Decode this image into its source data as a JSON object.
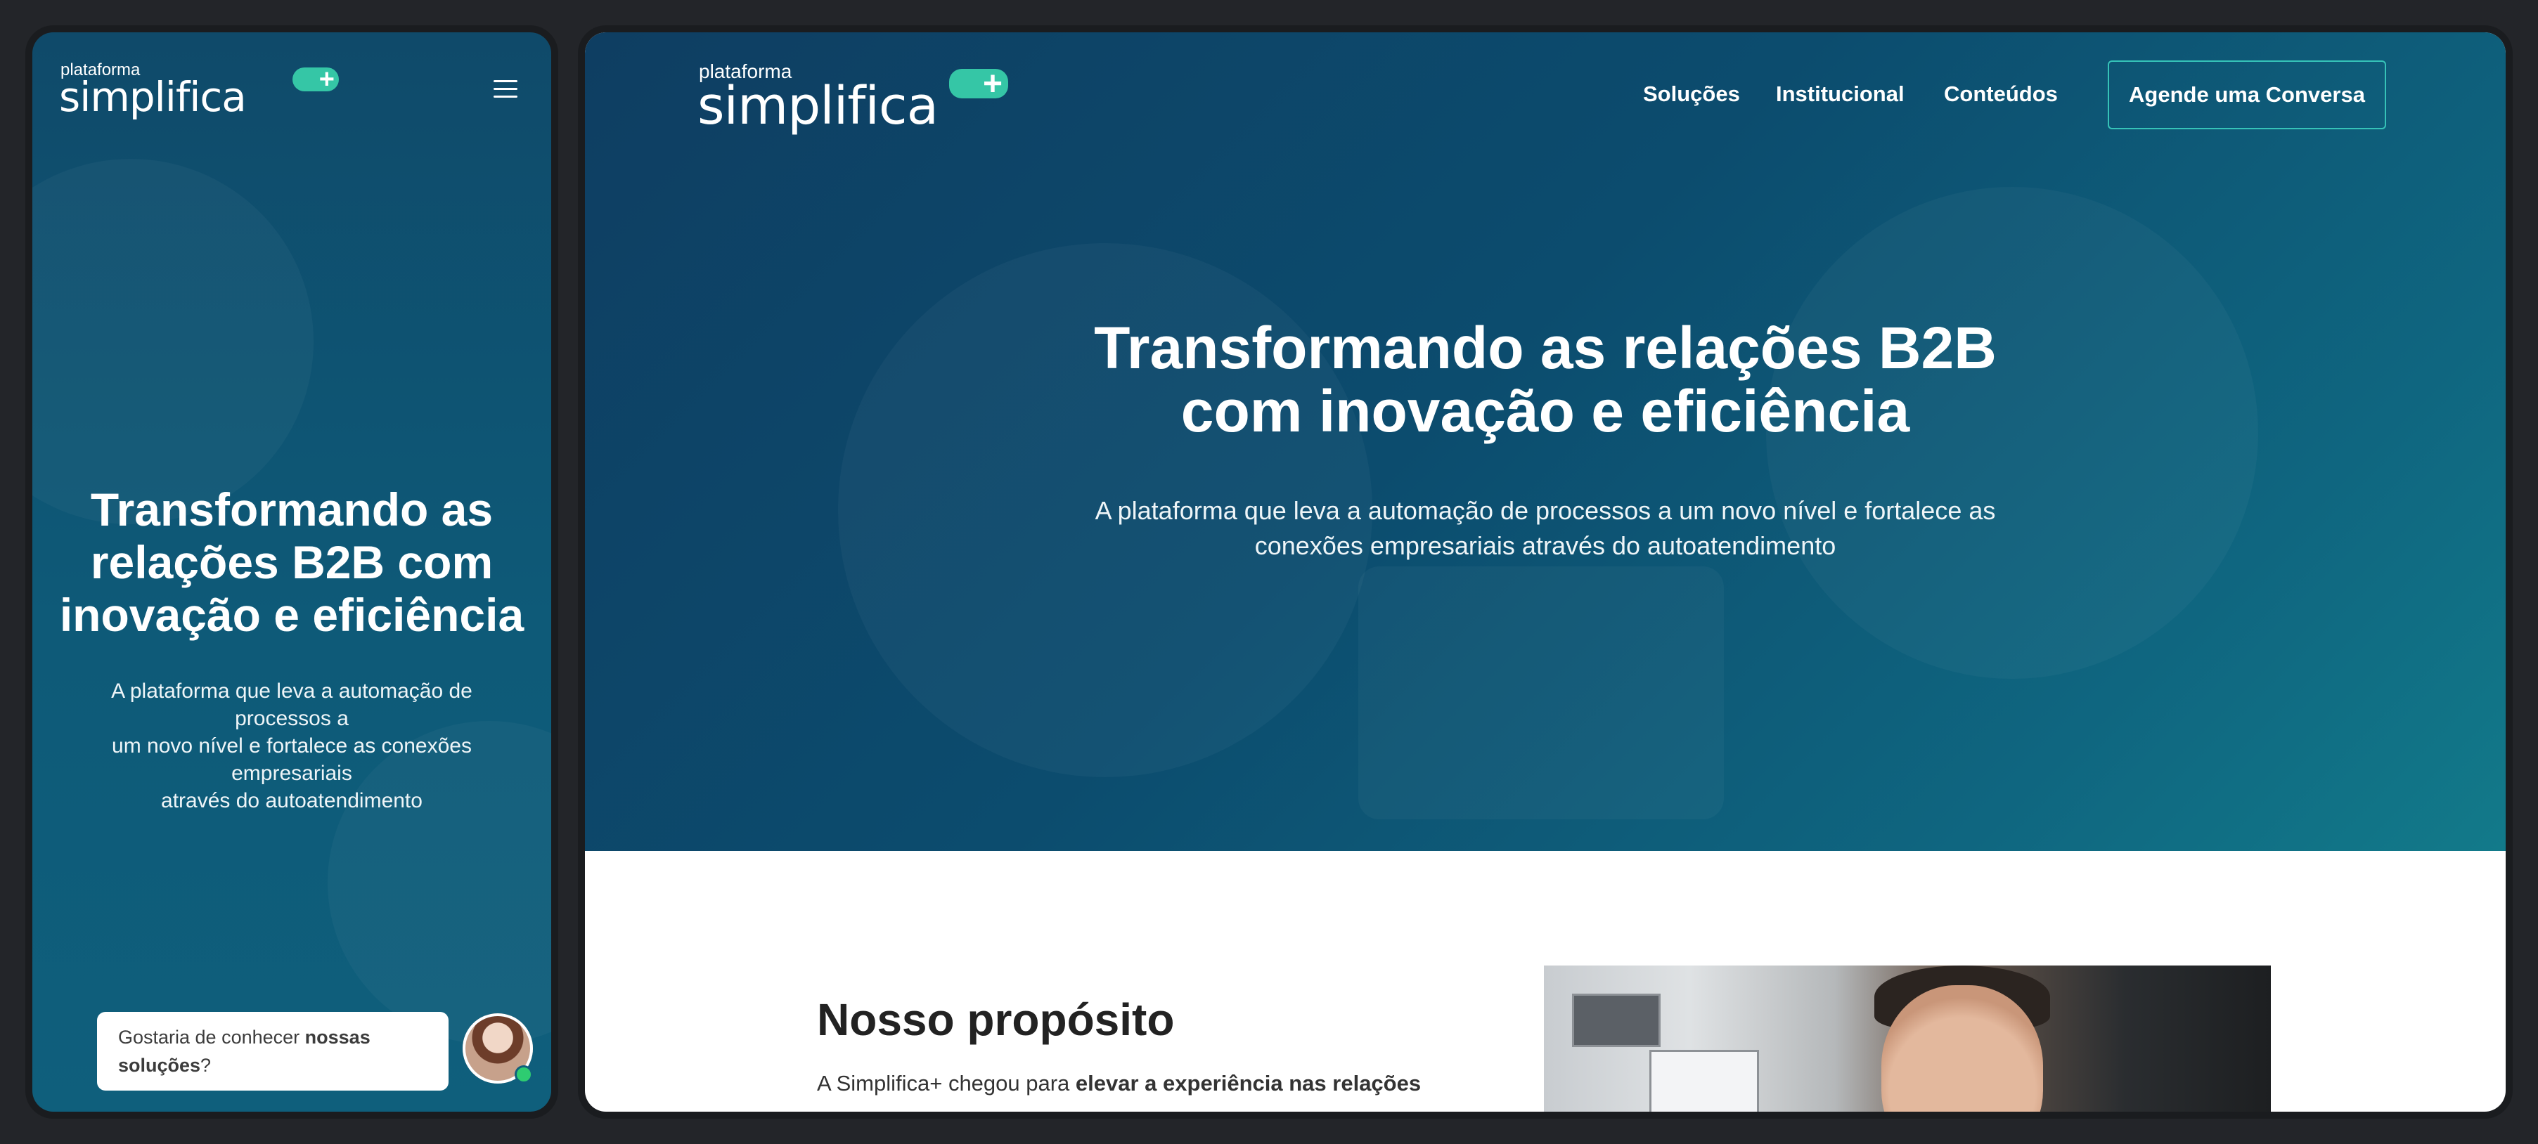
{
  "brand": {
    "logo_small": "plataforma",
    "logo_big": "simplifica",
    "logo_plus": "+",
    "accent_color": "#35c6a6"
  },
  "desktop": {
    "nav": {
      "items": [
        "Soluções",
        "Institucional",
        "Conteúdos"
      ],
      "cta_label": "Agende uma Conversa"
    },
    "hero": {
      "title_line1": "Transformando as relações B2B",
      "title_line2": "com inovação e eficiência",
      "subtitle_line1": "A plataforma que leva a automação de processos a um novo nível e fortalece as",
      "subtitle_line2": "conexões empresariais através do autoatendimento"
    },
    "purpose": {
      "title": "Nosso propósito",
      "text_plain": "A Simplifica+ chegou para ",
      "text_bold": "elevar a experiência nas relações"
    }
  },
  "mobile": {
    "menu_icon": "hamburger-menu-icon",
    "hero": {
      "title_line1": "Transformando as",
      "title_line2": "relações B2B com",
      "title_line3": "inovação e eficiência",
      "subtitle_line1": "A plataforma que leva a automação de processos a",
      "subtitle_line2": "um novo nível e fortalece as conexões empresariais",
      "subtitle_line3": "através do autoatendimento"
    },
    "chat": {
      "text_plain": "Gostaria de conhecer ",
      "text_bold": "nossas soluções",
      "text_end": "?",
      "status": "online"
    }
  }
}
